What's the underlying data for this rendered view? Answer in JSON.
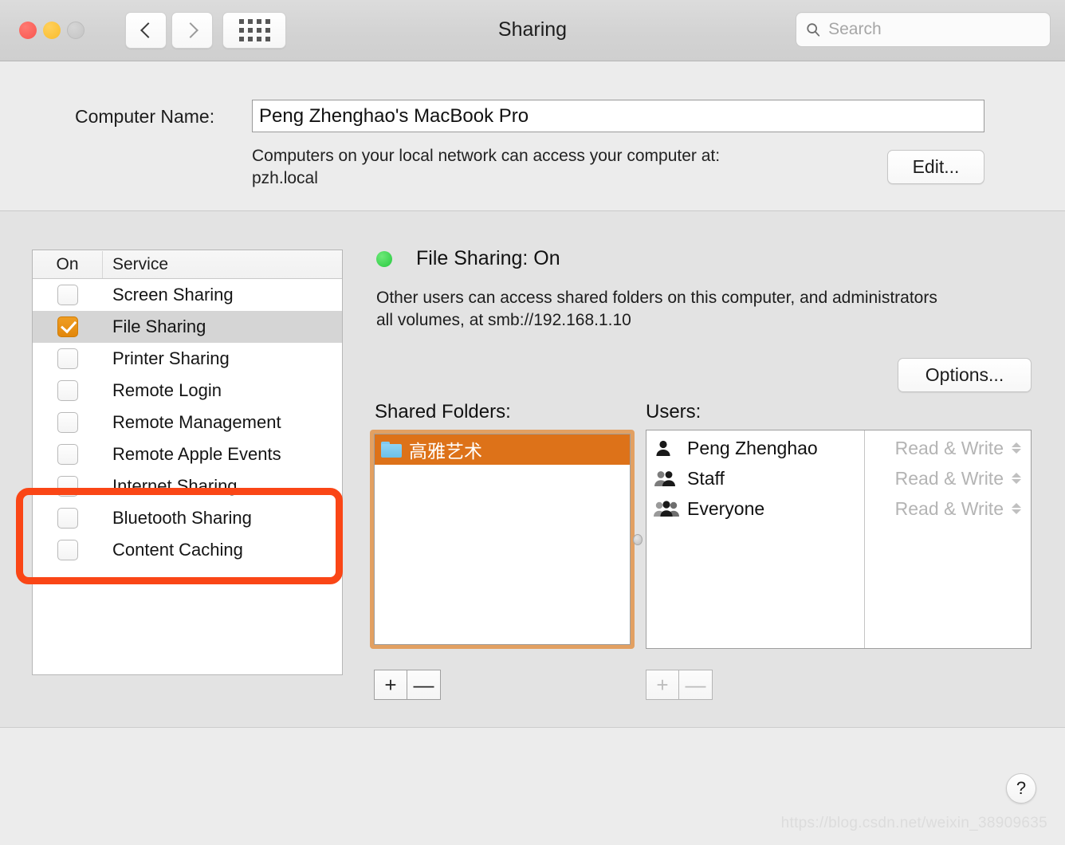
{
  "window": {
    "title": "Sharing",
    "traffic_lights": [
      "close",
      "minimize",
      "zoom"
    ],
    "back_icon": "chevron-left-icon",
    "forward_icon": "chevron-right-icon",
    "grid_icon": "show-all-grid-icon"
  },
  "search": {
    "value": "",
    "placeholder": "Search",
    "icon": "search-icon"
  },
  "computer_name": {
    "label": "Computer Name:",
    "value": "Peng Zhenghao's MacBook Pro",
    "description_line1": "Computers on your local network can access your computer at:",
    "description_line2": "pzh.local",
    "edit_label": "Edit..."
  },
  "services": {
    "header_on": "On",
    "header_service": "Service",
    "rows": [
      {
        "label": "Screen Sharing",
        "checked": false,
        "selected": false
      },
      {
        "label": "File Sharing",
        "checked": true,
        "selected": true
      },
      {
        "label": "Printer Sharing",
        "checked": false,
        "selected": false
      },
      {
        "label": "Remote Login",
        "checked": false,
        "selected": false
      },
      {
        "label": "Remote Management",
        "checked": false,
        "selected": false
      },
      {
        "label": "Remote Apple Events",
        "checked": false,
        "selected": false
      },
      {
        "label": "Internet Sharing",
        "checked": false,
        "selected": false
      },
      {
        "label": "Bluetooth Sharing",
        "checked": false,
        "selected": false
      },
      {
        "label": "Content Caching",
        "checked": false,
        "selected": false
      }
    ]
  },
  "annotation": {
    "color": "#fa4616",
    "shape": "rounded-rectangle"
  },
  "detail": {
    "status_indicator": "green",
    "status_color": "#28c940",
    "status_text": "File Sharing: On",
    "description_line1": "Other users can access shared folders on this computer, and administrators",
    "description_line2": "all volumes, at smb://192.168.1.10",
    "options_label": "Options..."
  },
  "shared_folders": {
    "label": "Shared Folders:",
    "selection_color": "#dd7219",
    "items": [
      {
        "name": "高雅艺术",
        "icon": "folder-icon",
        "selected": true
      }
    ],
    "add_label": "+",
    "remove_label": "—"
  },
  "users": {
    "label": "Users:",
    "rows": [
      {
        "name": "Peng Zhenghao",
        "icon": "single-person-icon",
        "permission": "Read & Write"
      },
      {
        "name": "Staff",
        "icon": "two-people-icon",
        "permission": "Read & Write"
      },
      {
        "name": "Everyone",
        "icon": "three-people-icon",
        "permission": "Read & Write"
      }
    ],
    "add_label": "+",
    "remove_label": "—",
    "buttons_enabled": false
  },
  "footer": {
    "help_label": "?",
    "watermark": "https://blog.csdn.net/weixin_38909635"
  }
}
